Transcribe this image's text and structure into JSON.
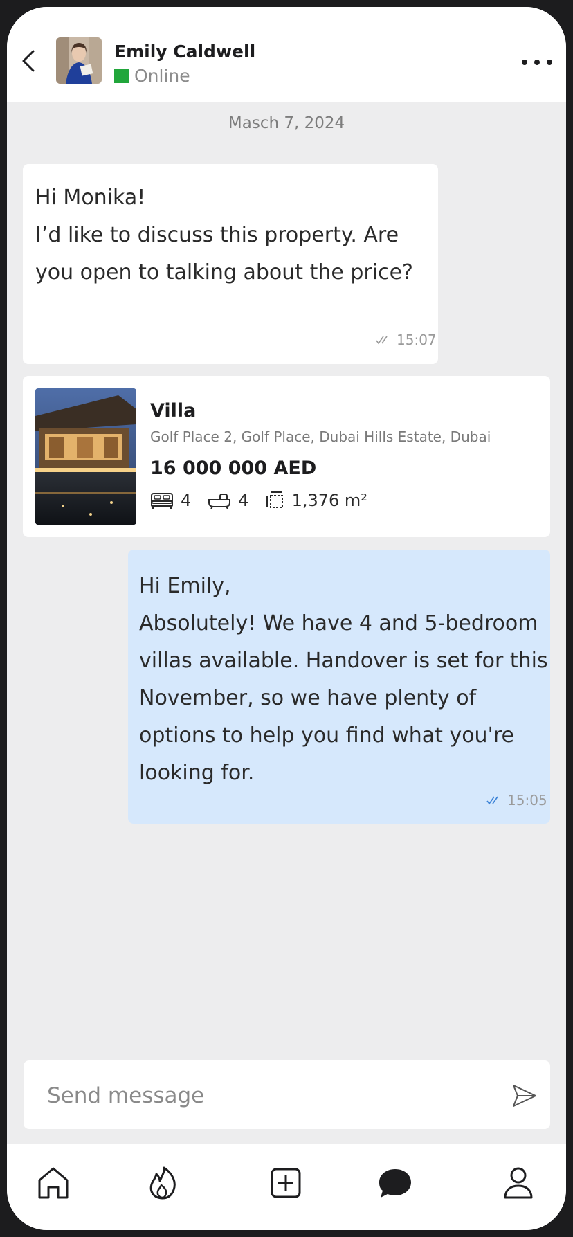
{
  "header": {
    "contact_name": "Emily Caldwell",
    "status": "Online",
    "status_color": "#21a63b"
  },
  "chat": {
    "date": "Masch 7, 2024",
    "incoming": {
      "text": "Hi Monika!\nI’d like to discuss this property. Are you open to talking about the price?",
      "time": "15:07"
    },
    "listing": {
      "title": "Villa",
      "address": "Golf Place 2, Golf Place, Dubai Hills Estate, Dubai",
      "price": "16 000 000 AED",
      "bedrooms": "4",
      "bathrooms": "4",
      "area": "1,376 m²"
    },
    "outgoing": {
      "text": "Hi Emily,\nAbsolutely! We have 4 and 5-bedroom villas available. Handover is set for this November, so we have plenty of options to help you find what you're looking for.",
      "time": "15:05",
      "bubble_color": "#d6e8fc"
    }
  },
  "composer": {
    "placeholder": "Send message"
  },
  "tabbar": {
    "icons": [
      "home-icon",
      "flame-icon",
      "plus-square-icon",
      "chat-icon",
      "profile-icon"
    ]
  }
}
